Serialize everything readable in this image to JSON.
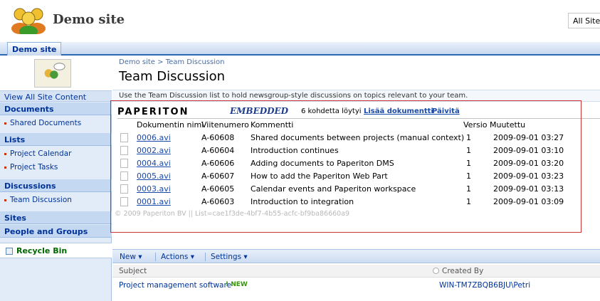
{
  "header": {
    "site_title": "Demo site",
    "search_scope": "All Sites",
    "home_tab": "Demo site"
  },
  "nav": {
    "view_all": "View All Site Content",
    "sections": [
      {
        "heading": "Documents",
        "items": [
          "Shared Documents"
        ]
      },
      {
        "heading": "Lists",
        "items": [
          "Project Calendar",
          "Project Tasks"
        ]
      },
      {
        "heading": "Discussions",
        "items": [
          "Team Discussion"
        ]
      },
      {
        "heading": "Sites",
        "items": []
      },
      {
        "heading": "People and Groups",
        "items": []
      }
    ],
    "recycle_bin": "Recycle Bin"
  },
  "main": {
    "breadcrumb": "Demo site > Team Discussion",
    "title": "Team Discussion",
    "description": "Use the Team Discussion list to hold newsgroup-style discussions on topics relevant to your team."
  },
  "paperiton": {
    "logo": "PAPERITON",
    "embedded": "EMBEDDED",
    "count_text": "6 kohdetta löytyi",
    "add_link": "Lisää dokumentti",
    "refresh_link": "Päivitä",
    "columns": {
      "name": "Dokumentin nimi",
      "ref": "Viitenumero",
      "comment": "Kommentti",
      "version": "Versio",
      "modified": "Muutettu"
    },
    "rows": [
      {
        "name": "0006.avi",
        "ref": "A-60608",
        "comment": "Shared documents between projects (manual context)",
        "version": "1",
        "modified": "2009-09-01 03:27"
      },
      {
        "name": "0002.avi",
        "ref": "A-60604",
        "comment": "Introduction continues",
        "version": "1",
        "modified": "2009-09-01 03:10"
      },
      {
        "name": "0004.avi",
        "ref": "A-60606",
        "comment": "Adding documents to Paperiton DMS",
        "version": "1",
        "modified": "2009-09-01 03:20"
      },
      {
        "name": "0005.avi",
        "ref": "A-60607",
        "comment": "How to add the Paperiton Web Part",
        "version": "1",
        "modified": "2009-09-01 03:23"
      },
      {
        "name": "0003.avi",
        "ref": "A-60605",
        "comment": "Calendar events and Paperiton workspace",
        "version": "1",
        "modified": "2009-09-01 03:13"
      },
      {
        "name": "0001.avi",
        "ref": "A-60603",
        "comment": "Introduction to integration",
        "version": "1",
        "modified": "2009-09-01 03:09"
      }
    ],
    "copyright": "© 2009 Paperiton BV || List=cae1f3de-4bf7-4b55-acfc-bf9ba86660a9"
  },
  "toolbar": {
    "new": "New",
    "actions": "Actions",
    "settings": "Settings"
  },
  "list": {
    "col_subject": "Subject",
    "col_created": "Created By",
    "row_subject": "Project management software",
    "row_new": "NEW",
    "row_creator": "WIN-TM7ZBQB6BJU\\Petri"
  }
}
